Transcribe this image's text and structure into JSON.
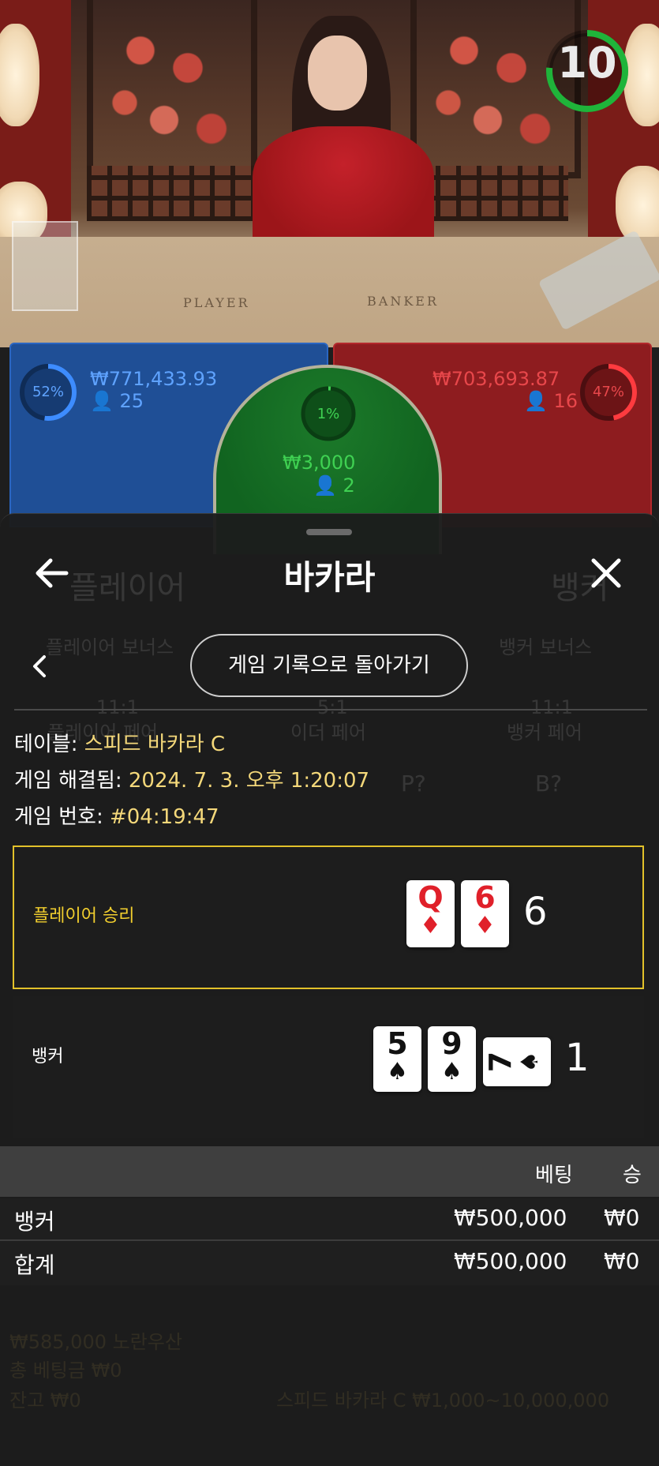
{
  "live": {
    "table_marks": {
      "player": "PLAYER",
      "banker": "BANKER"
    },
    "timer": "10",
    "colors": {
      "player": "#1f4f96",
      "banker": "#8e1c1f",
      "tie": "#116420",
      "highlight": "#e2c12a"
    }
  },
  "bets_panel": {
    "player": {
      "percent": "52%",
      "amount": "₩771,433.93",
      "players": "25",
      "percent_value": 52
    },
    "banker": {
      "percent": "47%",
      "amount": "₩703,693.87",
      "players": "16",
      "percent_value": 47
    },
    "tie": {
      "percent": "1%",
      "amount": "₩3,000",
      "players": "2",
      "percent_value": 1
    }
  },
  "background_labels": {
    "player_tab": "플레이어",
    "banker_tab": "뱅커",
    "player_bonus": "플레이어 보너스",
    "banker_bonus": "뱅커 보너스",
    "odds_left": "11:1",
    "player_pair": "플레이어 페어",
    "odds_mid": "5:1",
    "either_pair": "이더 페어",
    "odds_right": "11:1",
    "banker_pair": "뱅커 페어",
    "p_question": "P?",
    "b_question": "B?"
  },
  "sheet": {
    "title": "바카라",
    "back_button": "게임 기록으로 돌아가기",
    "table_label": "테이블: ",
    "table_value": "스피드 바카라 C",
    "resolved_label": "게임 해결됨: ",
    "resolved_value": "2024. 7. 3. 오후 1:20:07",
    "game_no_label": "게임 번호: ",
    "game_no_value": "#04:19:47"
  },
  "result": {
    "player": {
      "label": "플레이어 승리",
      "cards": [
        {
          "rank": "Q",
          "suit": "♦",
          "color": "red"
        },
        {
          "rank": "6",
          "suit": "♦",
          "color": "red"
        }
      ],
      "score": "6"
    },
    "banker": {
      "label": "뱅커",
      "cards": [
        {
          "rank": "5",
          "suit": "♠",
          "color": "black"
        },
        {
          "rank": "9",
          "suit": "♠",
          "color": "black"
        },
        {
          "rank": "7",
          "suit": "♠",
          "color": "black",
          "rotated": true
        }
      ],
      "score": "1"
    }
  },
  "bets_table": {
    "headers": {
      "bet": "베팅",
      "win": "승"
    },
    "rows": [
      {
        "name": "뱅커",
        "bet": "₩500,000",
        "win": "₩0"
      },
      {
        "name": "합계",
        "bet": "₩500,000",
        "win": "₩0"
      }
    ]
  },
  "background_footer": {
    "balance_line": "₩585,000 노란우산",
    "total_bet": "총 베팅금 ₩0",
    "balance": "잔고 ₩0",
    "table_limits": "스피드 바카라 C ₩1,000~10,000,000"
  }
}
